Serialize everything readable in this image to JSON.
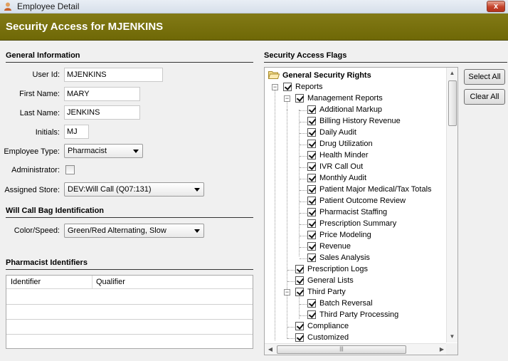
{
  "window": {
    "title": "Employee Detail",
    "close_label": "x"
  },
  "header": {
    "title": "Security Access for MJENKINS"
  },
  "general": {
    "heading": "General Information",
    "user_id_label": "User Id:",
    "user_id": "MJENKINS",
    "first_name_label": "First Name:",
    "first_name": "MARY",
    "last_name_label": "Last Name:",
    "last_name": "JENKINS",
    "initials_label": "Initials:",
    "initials": "MJ",
    "employee_type_label": "Employee Type:",
    "employee_type": "Pharmacist",
    "administrator_label": "Administrator:",
    "administrator": false,
    "assigned_store_label": "Assigned Store:",
    "assigned_store": "DEV:Will Call (Q07:131)"
  },
  "bag": {
    "heading": "Will Call Bag Identification",
    "color_speed_label": "Color/Speed:",
    "color_speed": "Green/Red Alternating, Slow"
  },
  "identifiers": {
    "heading": "Pharmacist Identifiers",
    "columns": [
      "Identifier",
      "Qualifier"
    ]
  },
  "flags": {
    "heading": "Security Access Flags",
    "root": "General Security Rights",
    "nodes": [
      "Reports",
      "Management Reports",
      "Additional Markup",
      "Billing History Revenue",
      "Daily Audit",
      "Drug Utilization",
      "Health Minder",
      "IVR Call Out",
      "Monthly Audit",
      "Patient Major Medical/Tax Totals",
      "Patient Outcome Review",
      "Pharmacist Staffing",
      "Prescription Summary",
      "Price Modeling",
      "Revenue",
      "Sales Analysis",
      "Prescription Logs",
      "General Lists",
      "Third Party",
      "Batch Reversal",
      "Third Party Processing",
      "Compliance",
      "Customized"
    ],
    "select_all_label": "Select All",
    "clear_all_label": "Clear All"
  },
  "colors": {
    "header_band": "#7a7312",
    "window_bg": "#f0f0f0"
  }
}
